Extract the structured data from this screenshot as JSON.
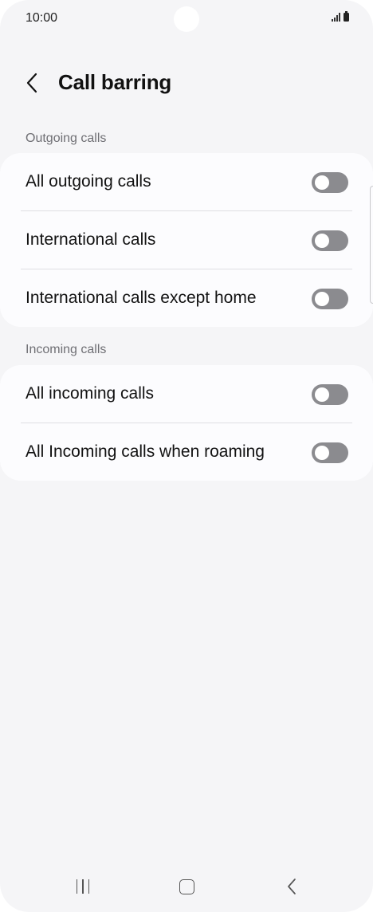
{
  "status_bar": {
    "time": "10:00"
  },
  "header": {
    "title": "Call barring",
    "back_icon": "chevron-left-icon"
  },
  "sections": [
    {
      "label": "Outgoing calls",
      "items": [
        {
          "label": "All outgoing calls",
          "enabled": false
        },
        {
          "label": "International calls",
          "enabled": false
        },
        {
          "label": "International calls except home",
          "enabled": false
        }
      ]
    },
    {
      "label": "Incoming calls",
      "items": [
        {
          "label": "All incoming calls",
          "enabled": false
        },
        {
          "label": "All Incoming calls when roaming",
          "enabled": false
        }
      ]
    }
  ],
  "nav_bar": {
    "icons": [
      "recents-icon",
      "home-icon",
      "back-icon"
    ]
  },
  "colors": {
    "background": "#f5f5f7",
    "card": "#fcfcfe",
    "toggle_off": "#8b8b8f",
    "section_label": "#6f6f74"
  }
}
